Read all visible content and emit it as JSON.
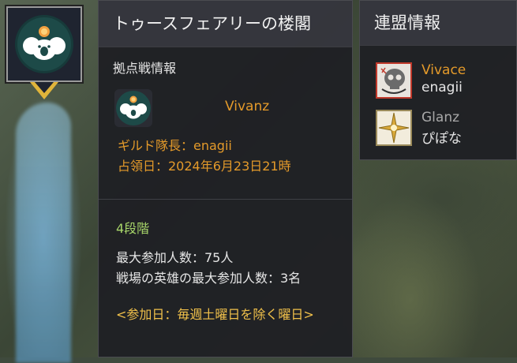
{
  "map": {
    "marker_colors": {
      "frame": "#9a9a9a",
      "pointer": "#e0b43a",
      "emblem_bg": "#173a3a"
    }
  },
  "territory": {
    "title": "トゥースフェアリーの楼閣",
    "section_label": "拠点戦情報",
    "guild_name": "Vivanz",
    "leader_line": "ギルド隊長：enagii",
    "occupied_line": "占領日：2024年6月23日21時",
    "stage": "4段階",
    "max_participants": "最大参加人数：75人",
    "hero_max": "戦場の英雄の最大参加人数：3名",
    "participation_days": "<参加日：毎週土曜日を除く曜日>"
  },
  "alliance": {
    "title": "連盟情報",
    "items": [
      {
        "name": "Vivace",
        "leader": "enagii",
        "name_color": "#e49a2a",
        "emblem": "skull-emblem-icon"
      },
      {
        "name": "Glanz",
        "leader": "ぴぽな",
        "name_color": "#a8a8a8",
        "emblem": "star-emblem-icon"
      }
    ]
  },
  "colors": {
    "orange": "#e49a2a",
    "green": "#a8d66a",
    "yellow": "#f0c04a",
    "panel_bg": "#1f2024"
  }
}
